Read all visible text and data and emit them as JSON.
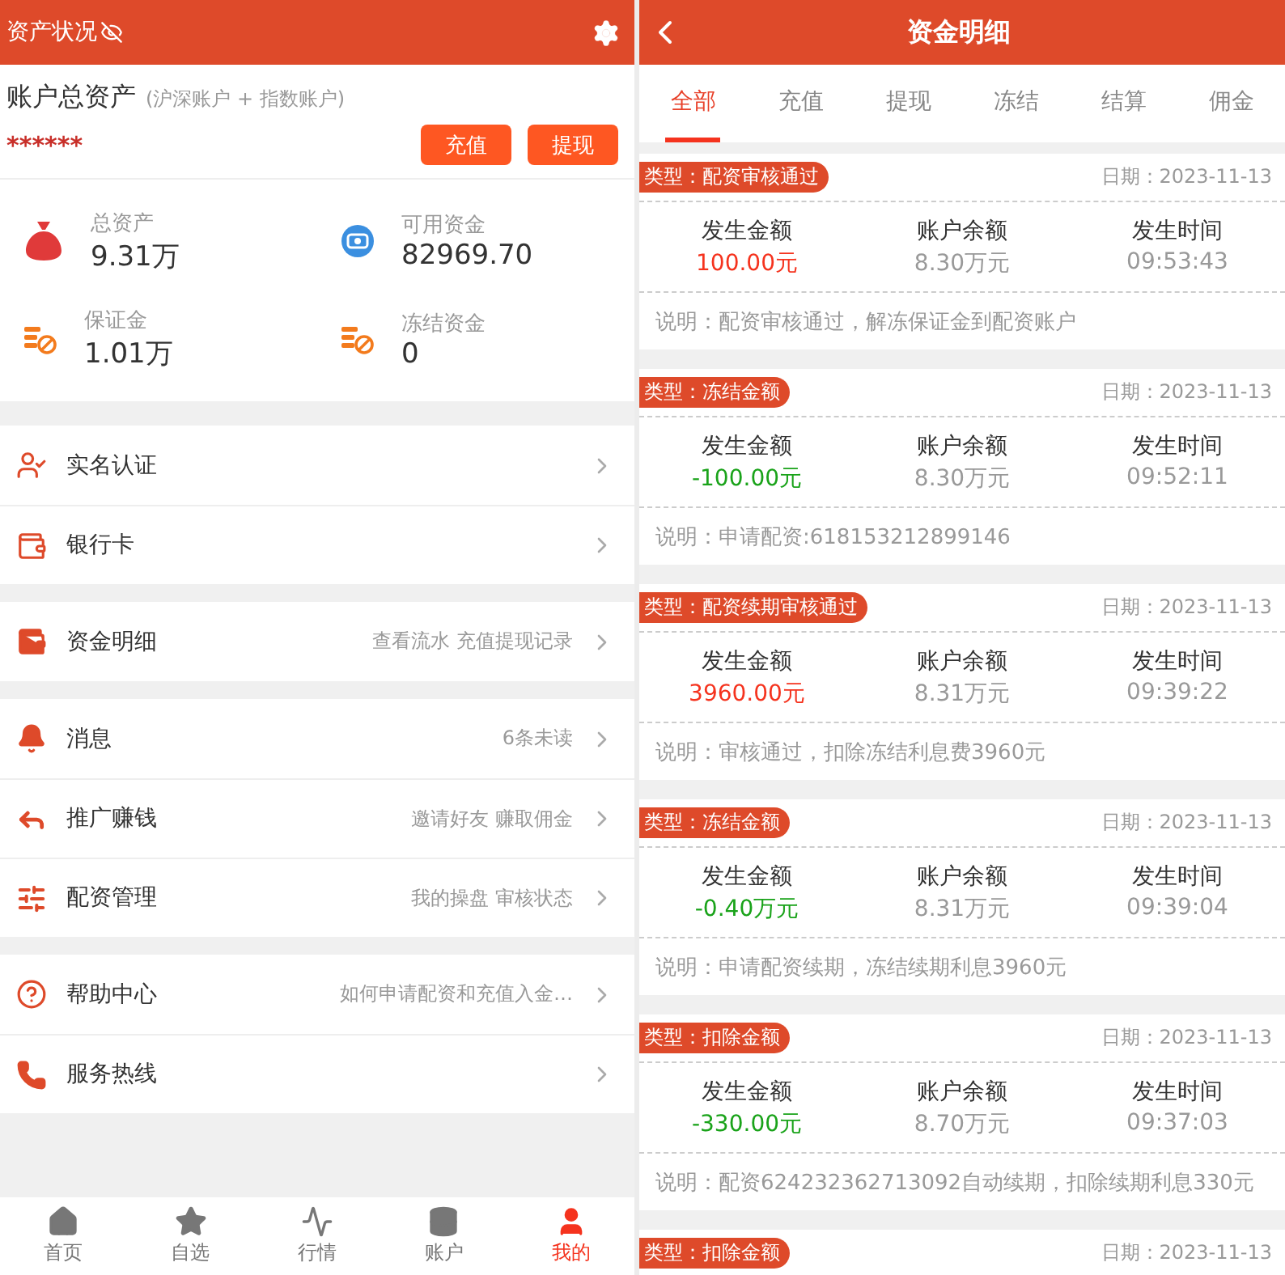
{
  "left_screen": {
    "header": {
      "title": "资产状况"
    },
    "assets": {
      "title": "账户总资产",
      "subtitle": "(沪深账户 + 指数账户)",
      "masked_total": "******",
      "buttons": [
        "充值",
        "提现"
      ]
    },
    "stats": [
      {
        "label": "总资产",
        "value": "9.31万"
      },
      {
        "label": "可用资金",
        "value": "82969.70"
      },
      {
        "label": "保证金",
        "value": "1.01万"
      },
      {
        "label": "冻结资金",
        "value": "0"
      }
    ],
    "menu_groups": [
      [
        {
          "label": "实名认证"
        },
        {
          "label": "银行卡"
        }
      ],
      [
        {
          "label": "资金明细",
          "hint": "查看流水 充值提现记录"
        }
      ],
      [
        {
          "label": "消息",
          "hint": "6条未读"
        },
        {
          "label": "推广赚钱",
          "hint": "邀请好友 赚取佣金"
        },
        {
          "label": "配资管理",
          "hint": "我的操盘 审核状态"
        }
      ],
      [
        {
          "label": "帮助中心",
          "hint": "如何申请配资和充值入金…"
        },
        {
          "label": "服务热线"
        }
      ]
    ],
    "tab_bar": [
      {
        "label": "首页",
        "selected": false
      },
      {
        "label": "自选",
        "selected": false
      },
      {
        "label": "行情",
        "selected": false
      },
      {
        "label": "账户",
        "selected": false
      },
      {
        "label": "我的",
        "selected": true
      }
    ]
  },
  "right_screen": {
    "header": {
      "title": "资金明细"
    },
    "tabs": [
      {
        "label": "全部",
        "selected": true
      },
      {
        "label": "充值",
        "selected": false
      },
      {
        "label": "提现",
        "selected": false
      },
      {
        "label": "冻结",
        "selected": false
      },
      {
        "label": "结算",
        "selected": false
      },
      {
        "label": "佣金",
        "selected": false
      }
    ],
    "records": [
      {
        "type": "类型：配资审核通过",
        "date": "日期：2023-11-13",
        "labels": [
          "发生金额",
          "账户余额",
          "发生时间"
        ],
        "kind": "income",
        "amount": "100.00元",
        "balance": "8.30万元",
        "time": "09:53:43",
        "note": "说明：配资审核通过，解冻保证金到配资账户"
      },
      {
        "type": "类型：冻结金额",
        "date": "日期：2023-11-13",
        "labels": [
          "发生金额",
          "账户余额",
          "发生时间"
        ],
        "kind": "expense",
        "amount": "-100.00元",
        "balance": "8.30万元",
        "time": "09:52:11",
        "note": "说明：申请配资:618153212899146"
      },
      {
        "type": "类型：配资续期审核通过",
        "date": "日期：2023-11-13",
        "labels": [
          "发生金额",
          "账户余额",
          "发生时间"
        ],
        "kind": "income",
        "amount": "3960.00元",
        "balance": "8.31万元",
        "time": "09:39:22",
        "note": "说明：审核通过，扣除冻结利息费3960元"
      },
      {
        "type": "类型：冻结金额",
        "date": "日期：2023-11-13",
        "labels": [
          "发生金额",
          "账户余额",
          "发生时间"
        ],
        "kind": "expense",
        "amount": "-0.40万元",
        "balance": "8.31万元",
        "time": "09:39:04",
        "note": "说明：申请配资续期，冻结续期利息3960元"
      },
      {
        "type": "类型：扣除金额",
        "date": "日期：2023-11-13",
        "labels": [
          "发生金额",
          "账户余额",
          "发生时间"
        ],
        "kind": "expense",
        "amount": "-330.00元",
        "balance": "8.70万元",
        "time": "09:37:03",
        "note": "说明：配资624232362713092自动续期，扣除续期利息330元"
      },
      {
        "type": "类型：扣除金额",
        "date": "日期：2023-11-13"
      }
    ]
  }
}
